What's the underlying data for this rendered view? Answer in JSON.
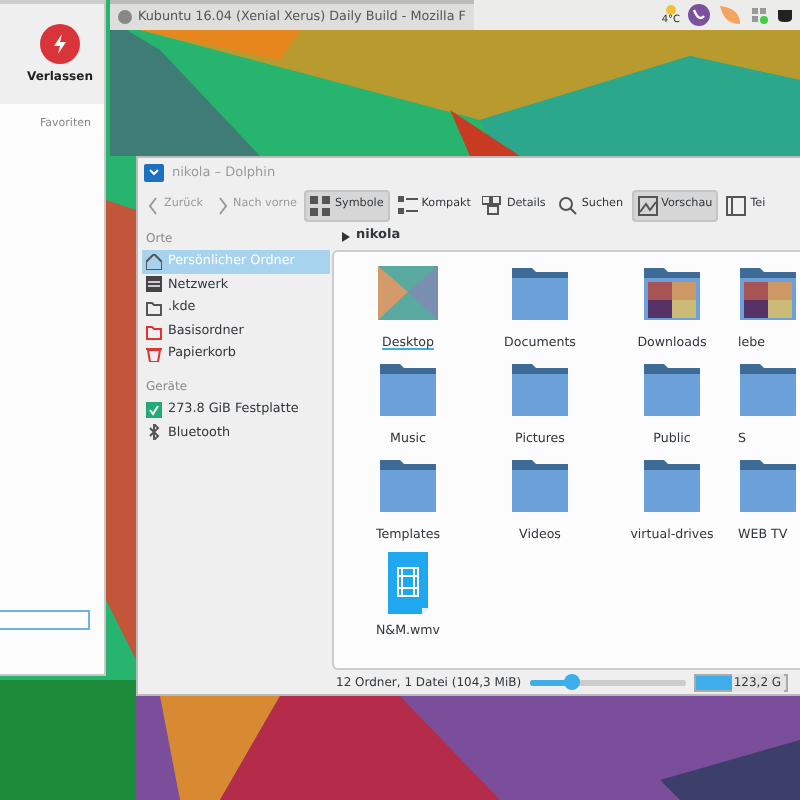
{
  "launcher": {
    "leave_button": "Verlassen",
    "section": "Favoriten"
  },
  "panel": {
    "task_title": "Kubuntu 16.04 (Xenial Xerus) Daily Build - Mozilla F",
    "weather": "4°C"
  },
  "dolphin": {
    "title": "nikola – Dolphin",
    "toolbar": [
      {
        "label": "Zurück",
        "kind": "back",
        "disabled": true,
        "selected": false
      },
      {
        "label": "Nach vorne",
        "kind": "forward",
        "disabled": true,
        "selected": false
      },
      {
        "label": "Symbole",
        "kind": "icons",
        "disabled": false,
        "selected": true
      },
      {
        "label": "Kompakt",
        "kind": "compact",
        "disabled": false,
        "selected": false
      },
      {
        "label": "Details",
        "kind": "details",
        "disabled": false,
        "selected": false
      },
      {
        "label": "Suchen",
        "kind": "search",
        "disabled": false,
        "selected": false
      },
      {
        "label": "Vorschau",
        "kind": "preview",
        "disabled": false,
        "selected": true
      },
      {
        "label": "Tei",
        "kind": "split",
        "disabled": false,
        "selected": false
      }
    ],
    "sidebar": [
      {
        "heading": "Orte",
        "items": [
          {
            "label": "Persönlicher Ordner",
            "kind": "home",
            "selected": true
          },
          {
            "label": "Netzwerk",
            "kind": "network",
            "selected": false
          },
          {
            "label": ".kde",
            "kind": "folder",
            "selected": false
          },
          {
            "label": "Basisordner",
            "kind": "root",
            "selected": false
          },
          {
            "label": "Papierkorb",
            "kind": "trash",
            "selected": false
          }
        ]
      },
      {
        "heading": "Geräte",
        "items": [
          {
            "label": "273.8 GiB Festplatte",
            "kind": "disk",
            "selected": false
          },
          {
            "label": "Bluetooth",
            "kind": "bluetooth",
            "selected": false
          }
        ]
      }
    ],
    "breadcrumb": "nikola",
    "files": [
      {
        "name": "Desktop",
        "kind": "wallpaper",
        "hovered": true
      },
      {
        "name": "Documents",
        "kind": "folder",
        "hovered": false
      },
      {
        "name": "Downloads",
        "kind": "photos",
        "hovered": false
      },
      {
        "name": "lebe",
        "kind": "photos",
        "hovered": false
      },
      {
        "name": "Music",
        "kind": "folder",
        "hovered": false
      },
      {
        "name": "Pictures",
        "kind": "folder",
        "hovered": false
      },
      {
        "name": "Public",
        "kind": "folder",
        "hovered": false
      },
      {
        "name": "S",
        "kind": "folder",
        "hovered": false
      },
      {
        "name": "Templates",
        "kind": "folder",
        "hovered": false
      },
      {
        "name": "Videos",
        "kind": "folder",
        "hovered": false
      },
      {
        "name": "virtual-drives",
        "kind": "folder",
        "hovered": false
      },
      {
        "name": "WEB TV",
        "kind": "folder",
        "hovered": false
      },
      {
        "name": "N&M.wmv",
        "kind": "video",
        "hovered": false
      }
    ],
    "status": {
      "text": "12 Ordner, 1 Datei (104,3 MiB)",
      "zoom": {
        "level": 0.27
      },
      "disk": {
        "level": 0.43,
        "reading": "123,2 G"
      }
    }
  }
}
